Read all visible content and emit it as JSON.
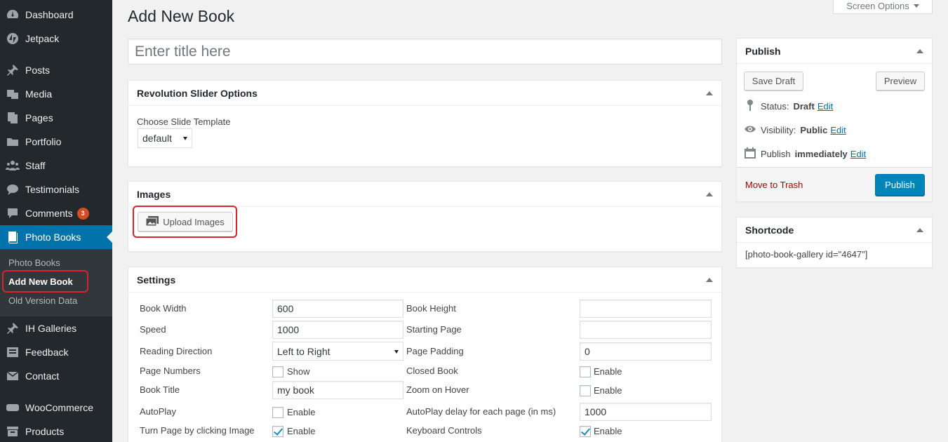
{
  "sidebar": {
    "items": [
      {
        "label": "Dashboard",
        "icon": "dashboard-icon"
      },
      {
        "label": "Jetpack",
        "icon": "jetpack-icon"
      },
      {
        "label": "Posts",
        "icon": "pin-icon"
      },
      {
        "label": "Media",
        "icon": "media-icon"
      },
      {
        "label": "Pages",
        "icon": "pages-icon"
      },
      {
        "label": "Portfolio",
        "icon": "folder-icon"
      },
      {
        "label": "Staff",
        "icon": "groups-icon"
      },
      {
        "label": "Testimonials",
        "icon": "testimonial-icon"
      },
      {
        "label": "Comments",
        "icon": "comments-icon",
        "badge": "3"
      },
      {
        "label": "Photo Books",
        "icon": "book-icon"
      },
      {
        "label": "IH Galleries",
        "icon": "pin-icon"
      },
      {
        "label": "Feedback",
        "icon": "feedback-icon"
      },
      {
        "label": "Contact",
        "icon": "email-icon"
      },
      {
        "label": "WooCommerce",
        "icon": "woo-icon"
      },
      {
        "label": "Products",
        "icon": "archive-icon"
      }
    ],
    "submenu": [
      "Photo Books",
      "Add New Book",
      "Old Version Data"
    ]
  },
  "header": {
    "title": "Add New Book",
    "screen_options": "Screen Options"
  },
  "title_input": {
    "placeholder": "Enter title here"
  },
  "slider_box": {
    "title": "Revolution Slider Options",
    "label": "Choose Slide Template",
    "selected": "default"
  },
  "images_box": {
    "title": "Images",
    "upload_label": "Upload Images"
  },
  "settings": {
    "title": "Settings",
    "book_width_label": "Book Width",
    "book_width": "600",
    "book_height_label": "Book Height",
    "book_height": "",
    "speed_label": "Speed",
    "speed": "1000",
    "starting_page_label": "Starting Page",
    "starting_page": "",
    "reading_direction_label": "Reading Direction",
    "reading_direction": "Left to Right",
    "page_padding_label": "Page Padding",
    "page_padding": "0",
    "page_numbers_label": "Page Numbers",
    "page_numbers_cb": "Show",
    "closed_book_label": "Closed Book",
    "closed_book_cb": "Enable",
    "book_title_label": "Book Title",
    "book_title": "my book",
    "zoom_label": "Zoom on Hover",
    "zoom_cb": "Enable",
    "autoplay_label": "AutoPlay",
    "autoplay_cb": "Enable",
    "autoplay_delay_label": "AutoPlay delay for each page (in ms)",
    "autoplay_delay": "1000",
    "turn_page_label": "Turn Page by clicking Image",
    "turn_page_cb": "Enable",
    "keyboard_label": "Keyboard Controls",
    "keyboard_cb": "Enable"
  },
  "publish": {
    "title": "Publish",
    "save_draft": "Save Draft",
    "preview": "Preview",
    "status_label": "Status:",
    "status_value": "Draft",
    "visibility_label": "Visibility:",
    "visibility_value": "Public",
    "publish_label": "Publish",
    "publish_value": "immediately",
    "edit": "Edit",
    "trash": "Move to Trash",
    "publish_button": "Publish"
  },
  "shortcode": {
    "title": "Shortcode",
    "value": "[photo-book-gallery id=\"4647\"]"
  },
  "colors": {
    "accent": "#0073aa",
    "sidebar": "#23282d",
    "highlight": "#d9232d"
  }
}
